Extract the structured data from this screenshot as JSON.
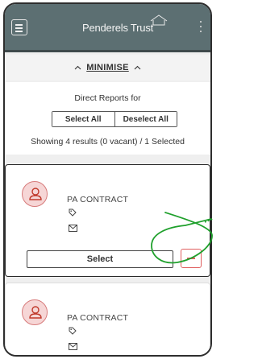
{
  "header": {
    "logo_text": "Penderels Trust",
    "menu_icon": "hamburger-menu-icon",
    "more_icon": "kebab-menu-icon"
  },
  "minimise": {
    "label": "MINIMISE",
    "icon": "caret-up-icon"
  },
  "direct_reports": {
    "title": "Direct Reports for",
    "select_all": "Select All",
    "deselect_all": "Deselect All",
    "results": "Showing 4 results (0 vacant) / 1 Selected"
  },
  "cards": [
    {
      "name": "PA CONTRACT",
      "select_label": "Select",
      "selected": true
    },
    {
      "name": "PA CONTRACT",
      "selected": false
    }
  ],
  "colors": {
    "header_bg": "#5c6f72",
    "accent_red": "#e05f5f",
    "annotation_green": "#1fa02c"
  }
}
